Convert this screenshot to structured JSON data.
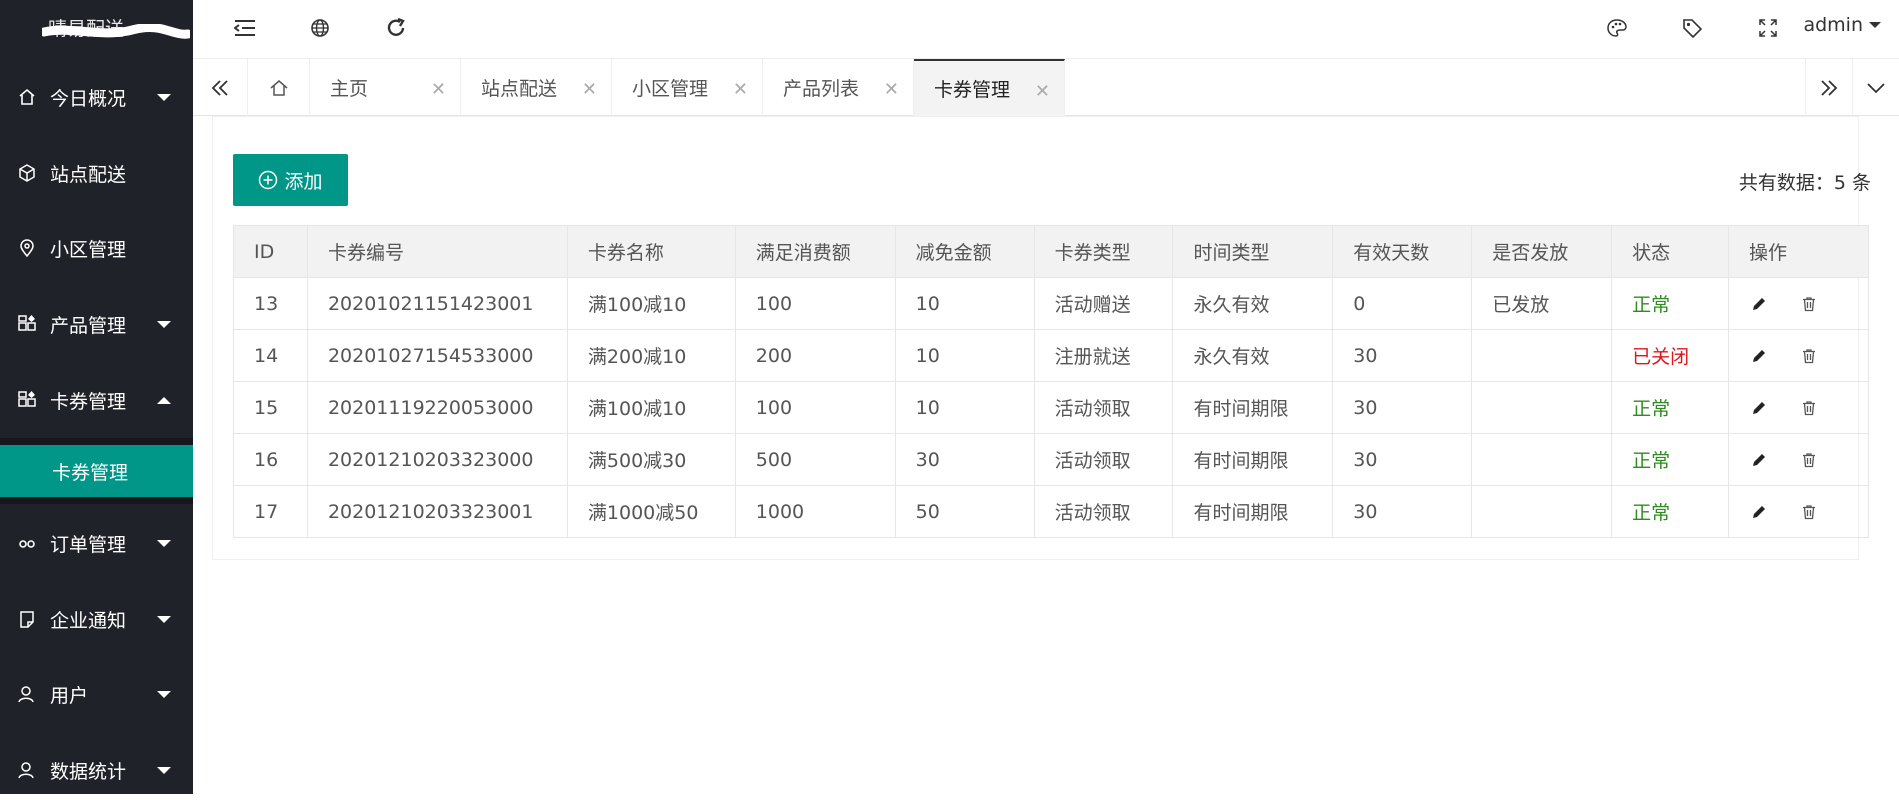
{
  "app": {
    "logo_text": "晴易配送"
  },
  "sidebar": {
    "items": [
      {
        "label": "今日概况",
        "icon": "home-icon",
        "caret": "down"
      },
      {
        "label": "站点配送",
        "icon": "cube-icon",
        "caret": ""
      },
      {
        "label": "小区管理",
        "icon": "location-icon",
        "caret": ""
      },
      {
        "label": "产品管理",
        "icon": "apps-icon",
        "caret": "down"
      },
      {
        "label": "卡券管理",
        "icon": "apps-icon",
        "caret": "up"
      },
      {
        "label": "订单管理",
        "icon": "link-icon",
        "caret": "down"
      },
      {
        "label": "企业通知",
        "icon": "note-icon",
        "caret": "down"
      },
      {
        "label": "用户",
        "icon": "user-icon",
        "caret": "down"
      },
      {
        "label": "数据统计",
        "icon": "user-icon",
        "caret": "down"
      }
    ],
    "submenu": {
      "label": "卡券管理"
    }
  },
  "header": {
    "user": "admin"
  },
  "tabs": [
    {
      "label": "主页"
    },
    {
      "label": "站点配送"
    },
    {
      "label": "小区管理"
    },
    {
      "label": "产品列表"
    },
    {
      "label": "卡券管理",
      "active": true
    }
  ],
  "toolbar": {
    "add_label": "添加",
    "total_text": "共有数据：5 条"
  },
  "table": {
    "headers": [
      "ID",
      "卡券编号",
      "卡券名称",
      "满足消费额",
      "减免金额",
      "卡券类型",
      "时间类型",
      "有效天数",
      "是否发放",
      "状态",
      "操作"
    ],
    "rows": [
      [
        "13",
        "20201021151423001",
        "满100减10",
        "100",
        "10",
        "活动赠送",
        "永久有效",
        "0",
        "已发放",
        "正常"
      ],
      [
        "14",
        "20201027154533000",
        "满200减10",
        "200",
        "10",
        "注册就送",
        "永久有效",
        "30",
        "",
        "已关闭"
      ],
      [
        "15",
        "20201119220053000",
        "满100减10",
        "100",
        "10",
        "活动领取",
        "有时间期限",
        "30",
        "",
        "正常"
      ],
      [
        "16",
        "20201210203323000",
        "满500减30",
        "500",
        "30",
        "活动领取",
        "有时间期限",
        "30",
        "",
        "正常"
      ],
      [
        "17",
        "20201210203323001",
        "满1000减50",
        "1000",
        "50",
        "活动领取",
        "有时间期限",
        "30",
        "",
        "正常"
      ]
    ]
  },
  "colors": {
    "accent": "#009688",
    "sidebar_bg": "#20222a",
    "status_ok": "#2e8b20",
    "status_off": "#e0151b"
  }
}
